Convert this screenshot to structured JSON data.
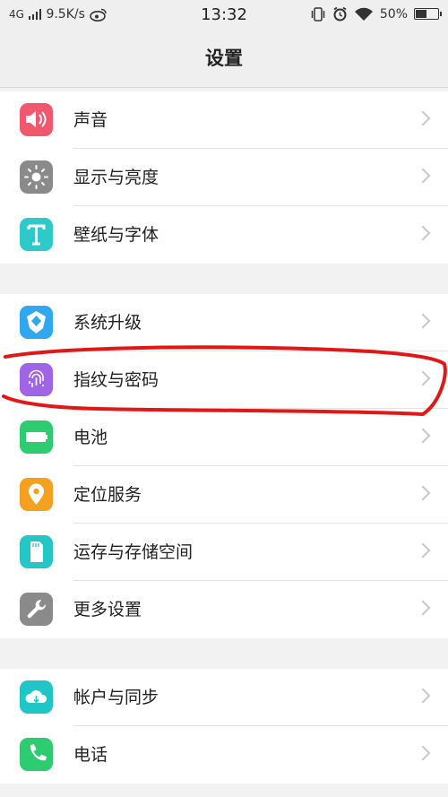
{
  "status_bar": {
    "network": "4G",
    "speed": "9.5K/s",
    "time": "13:32",
    "battery_percent": "50%",
    "battery_level": 0.5
  },
  "header": {
    "title": "设置"
  },
  "groups": [
    {
      "items": [
        {
          "label": "声音",
          "icon": "speaker-icon",
          "color": "#f0586e"
        },
        {
          "label": "显示与亮度",
          "icon": "brightness-icon",
          "color": "#8a8a8a"
        },
        {
          "label": "壁纸与字体",
          "icon": "font-icon",
          "color": "#2ec9c9"
        }
      ]
    },
    {
      "items": [
        {
          "label": "系统升级",
          "icon": "upgrade-icon",
          "color": "#2ea8f0"
        },
        {
          "label": "指纹与密码",
          "icon": "fingerprint-icon",
          "color": "#a064e6"
        },
        {
          "label": "电池",
          "icon": "battery-icon",
          "color": "#2ecc71"
        },
        {
          "label": "定位服务",
          "icon": "location-icon",
          "color": "#f5a020"
        },
        {
          "label": "运存与存储空间",
          "icon": "sd-card-icon",
          "color": "#26c6c6"
        },
        {
          "label": "更多设置",
          "icon": "wrench-icon",
          "color": "#8a8a8a"
        }
      ]
    },
    {
      "items": [
        {
          "label": "帐户与同步",
          "icon": "cloud-sync-icon",
          "color": "#20c6c6"
        },
        {
          "label": "电话",
          "icon": "phone-icon",
          "color": "#2ecc71"
        }
      ]
    }
  ],
  "colors": {
    "annotation_red": "#e01818"
  }
}
